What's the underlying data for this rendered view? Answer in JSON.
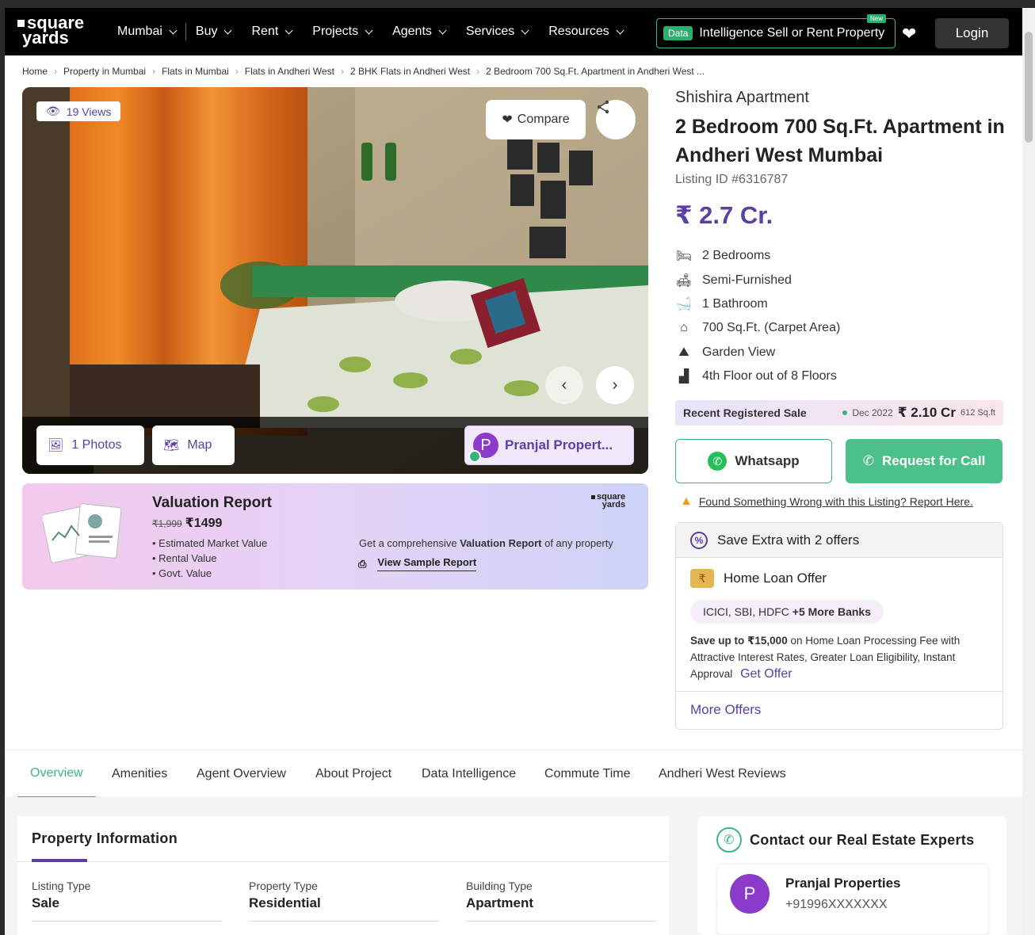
{
  "header": {
    "logo_line1": "square",
    "logo_line2": "yards",
    "nav": [
      {
        "label": "Mumbai"
      },
      {
        "label": "Buy"
      },
      {
        "label": "Rent"
      },
      {
        "label": "Projects"
      },
      {
        "label": "Agents"
      },
      {
        "label": "Services"
      },
      {
        "label": "Resources"
      }
    ],
    "data_tag": "Data",
    "data_intelligence": "Intelligence Sell or Rent Property",
    "new_tag": "New",
    "login": "Login"
  },
  "breadcrumb": [
    "Home",
    "Property in Mumbai",
    "Flats in Mumbai",
    "Flats in Andheri West",
    "2 BHK Flats in Andheri West",
    "2 Bedroom 700 Sq.Ft. Apartment in Andheri West ..."
  ],
  "gallery": {
    "views": "19 Views",
    "compare": "Compare",
    "photos": "1 Photos",
    "map": "Map",
    "agent_initial": "P",
    "agent_chip": "Pranjal Propert..."
  },
  "valuation": {
    "title": "Valuation Report",
    "old_price": "₹1,999",
    "price": "₹1499",
    "items": [
      "Estimated Market Value",
      "Rental Value",
      "Govt. Value"
    ],
    "logo_line1": "square",
    "logo_line2": "yards",
    "desc_pre": "Get a comprehensive ",
    "desc_bold": "Valuation Report",
    "desc_post": " of any property",
    "sample_link": "View Sample Report"
  },
  "listing": {
    "project": "Shishira Apartment",
    "title": "2 Bedroom 700 Sq.Ft. Apartment in Andheri West Mumbai",
    "listing_id": "Listing ID #6316787",
    "price": "₹ 2.7 Cr.",
    "features": [
      {
        "icon": "bed-icon",
        "glyph": "🛏",
        "text": "2 Bedrooms"
      },
      {
        "icon": "sofa-icon",
        "glyph": "🛋",
        "text": "Semi-Furnished"
      },
      {
        "icon": "bathtub-icon",
        "glyph": "🛁",
        "text": "1 Bathroom"
      },
      {
        "icon": "home-icon",
        "glyph": "⌂",
        "text": "700 Sq.Ft. (Carpet Area)"
      },
      {
        "icon": "landscape-icon",
        "glyph": "⛰",
        "text": "Garden View"
      },
      {
        "icon": "stairs-icon",
        "glyph": "▟",
        "text": "4th Floor out of 8 Floors"
      }
    ],
    "recent_sale_label": "Recent Registered Sale",
    "recent_sale_date": "Dec 2022",
    "recent_sale_amount": "₹ 2.10 Cr",
    "recent_sale_area": "612 Sq.ft",
    "whatsapp": "Whatsapp",
    "request_call": "Request for Call",
    "report_text": "Found Something Wrong with this Listing? Report Here."
  },
  "offers": {
    "heading": "Save Extra with 2 offers",
    "home_loan_title": "Home Loan Offer",
    "banks": "ICICI, SBI, HDFC",
    "banks_more": "+5 More Banks",
    "desc_bold": "Save up to ₹15,000",
    "desc": " on Home Loan Processing Fee with Attractive Interest Rates, Greater Loan Eligibility, Instant Approval",
    "get_offer": "Get Offer",
    "more_offers": "More Offers"
  },
  "tabs": [
    "Overview",
    "Amenities",
    "Agent Overview",
    "About Project",
    "Data Intelligence",
    "Commute Time",
    "Andheri West Reviews"
  ],
  "property_info": {
    "title": "Property Information",
    "fields": [
      {
        "label": "Listing Type",
        "value": "Sale"
      },
      {
        "label": "Property Type",
        "value": "Residential"
      },
      {
        "label": "Building Type",
        "value": "Apartment"
      }
    ]
  },
  "contact": {
    "heading": "Contact our Real Estate Experts",
    "agent_initial": "P",
    "agent_name": "Pranjal Properties",
    "agent_phone": "+91996XXXXXXX"
  },
  "colors": {
    "brand_purple": "#5b3fa3",
    "green": "#3bb58c",
    "header_bg": "#000000"
  }
}
